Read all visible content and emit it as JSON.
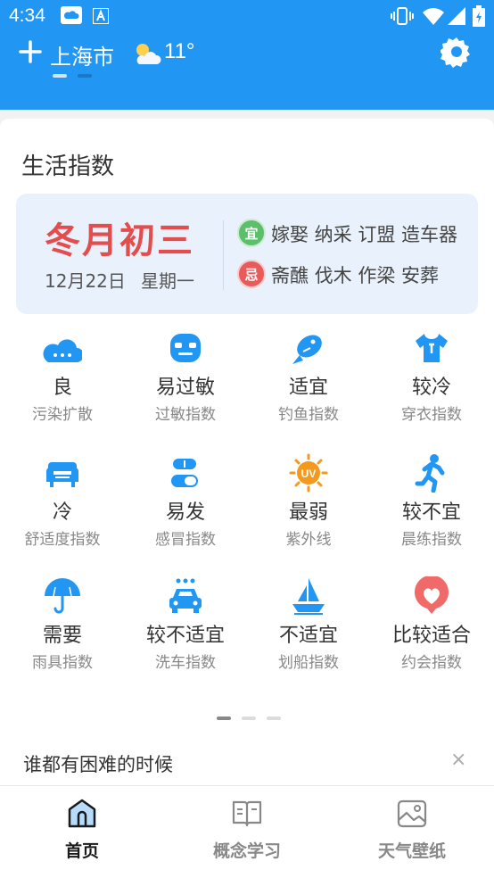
{
  "status_bar": {
    "time": "4:34"
  },
  "top_bar": {
    "city": "上海市",
    "temperature": "11°",
    "weather_icon": "partly-cloudy-icon"
  },
  "section": {
    "title": "生活指数"
  },
  "almanac": {
    "lunar_date": "冬月初三",
    "date": "12月22日",
    "weekday": "星期一",
    "yi_badge": "宜",
    "yi_items": "嫁娶 纳采 订盟 造车器",
    "ji_badge": "忌",
    "ji_items": "斋醮 伐木 作梁 安葬"
  },
  "indices": [
    {
      "value": "良",
      "label": "污染扩散",
      "icon": "cloud-icon"
    },
    {
      "value": "易过敏",
      "label": "过敏指数",
      "icon": "mask-icon"
    },
    {
      "value": "适宜",
      "label": "钓鱼指数",
      "icon": "fish-icon"
    },
    {
      "value": "较冷",
      "label": "穿衣指数",
      "icon": "tshirt-icon"
    },
    {
      "value": "冷",
      "label": "舒适度指数",
      "icon": "sofa-icon"
    },
    {
      "value": "易发",
      "label": "感冒指数",
      "icon": "pill-icon"
    },
    {
      "value": "最弱",
      "label": "紫外线",
      "icon": "uv-sun-icon"
    },
    {
      "value": "较不宜",
      "label": "晨练指数",
      "icon": "runner-icon"
    },
    {
      "value": "需要",
      "label": "雨具指数",
      "icon": "umbrella-icon"
    },
    {
      "value": "较不适宜",
      "label": "洗车指数",
      "icon": "car-wash-icon"
    },
    {
      "value": "不适宜",
      "label": "划船指数",
      "icon": "sailboat-icon"
    },
    {
      "value": "比较适合",
      "label": "约会指数",
      "icon": "heart-icon"
    }
  ],
  "notice": {
    "text": "谁都有困难的时候",
    "close": "×"
  },
  "bottom_nav": [
    {
      "label": "首页",
      "icon": "home-icon",
      "active": true
    },
    {
      "label": "概念学习",
      "icon": "book-icon",
      "active": false
    },
    {
      "label": "天气壁纸",
      "icon": "wallpaper-icon",
      "active": false
    }
  ],
  "colors": {
    "header_bg": "#2196f3",
    "accent_blue": "#2196f3",
    "lunar_red": "#e44d4d",
    "yi_green": "#5cbf6b",
    "ji_red": "#e95a5a",
    "uv_orange": "#f39a1e",
    "heart_red": "#f06a6a",
    "nav_active": "#1a1a1a",
    "nav_inactive": "#888888"
  }
}
